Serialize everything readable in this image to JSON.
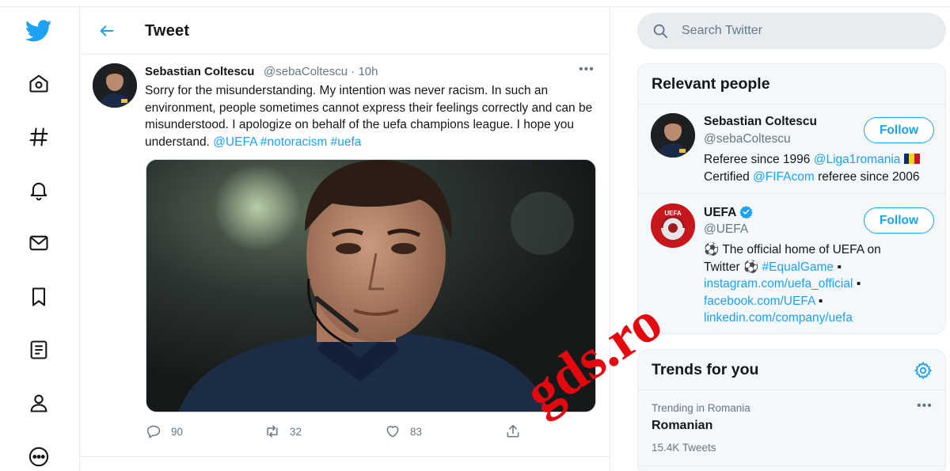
{
  "nav": {
    "items": [
      {
        "icon": "twitter-bird-icon",
        "label": "Twitter"
      },
      {
        "icon": "home-icon",
        "label": "Home"
      },
      {
        "icon": "hashtag-icon",
        "label": "Explore"
      },
      {
        "icon": "bell-icon",
        "label": "Notifications"
      },
      {
        "icon": "mail-icon",
        "label": "Messages"
      },
      {
        "icon": "bookmark-icon",
        "label": "Bookmarks"
      },
      {
        "icon": "list-icon",
        "label": "Lists"
      },
      {
        "icon": "person-icon",
        "label": "Profile"
      },
      {
        "icon": "more-circle-icon",
        "label": "More"
      }
    ]
  },
  "header": {
    "title": "Tweet"
  },
  "tweet": {
    "author_name": "Sebastian Coltescu",
    "meta": "@sebaColtescu · 10h",
    "more": "•••",
    "text_plain": "Sorry for the misunderstanding. My intention was never racism. In such an environment, people sometimes cannot express their feelings correctly and can be misunderstood. I apologize on behalf of the uefa champions league. I hope you understand.",
    "mention": "@UEFA",
    "hashtag1": "#notoracism",
    "hashtag2": "#uefa",
    "replies": "90",
    "retweets": "32",
    "likes": "83"
  },
  "watermark": "gds.ro",
  "search": {
    "placeholder": "Search Twitter"
  },
  "relevant_people": {
    "title": "Relevant people",
    "people": [
      {
        "name": "Sebastian Coltescu",
        "handle": "@sebaColtescu",
        "bio_1": "Referee since 1996 ",
        "bio_link1": "@Liga1romania",
        "bio_flag": "🇷🇴",
        "bio_2": "Certified ",
        "bio_link2": "@FIFAcom",
        "bio_3": " referee since 2006",
        "follow": "Follow"
      },
      {
        "name": "UEFA",
        "handle": "@UEFA",
        "verified": true,
        "bio_1": "⚽ The official home of UEFA on Twitter ⚽ ",
        "bio_tag": "#EqualGame",
        "bio_sep": " ▪",
        "bio_link1": "instagram.com/uefa_official",
        "bio_link2": "facebook.com/UEFA",
        "bio_link3": "linkedin.com/company/uefa",
        "follow": "Follow"
      }
    ]
  },
  "trends": {
    "title": "Trends for you",
    "items": [
      {
        "location": "Trending in Romania",
        "name": "Romanian",
        "count": "15.4K Tweets",
        "more": "•••"
      }
    ]
  },
  "colors": {
    "accent": "#1da1f2",
    "text": "#14171a",
    "muted": "#657786",
    "watermark": "#e4090f"
  }
}
